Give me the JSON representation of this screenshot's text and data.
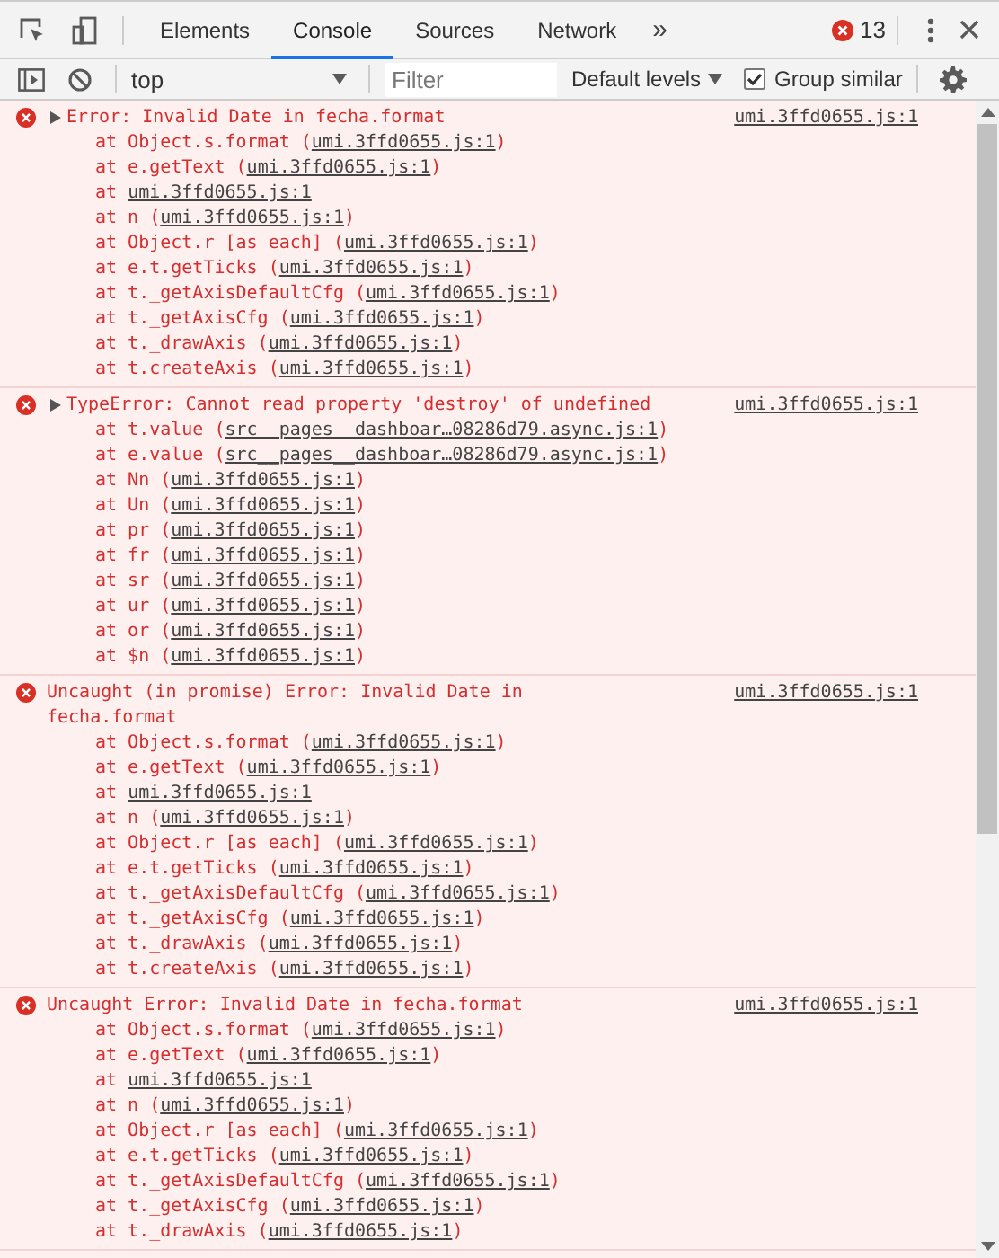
{
  "toolbar": {
    "tabs": [
      {
        "label": "Elements",
        "selected": false
      },
      {
        "label": "Console",
        "selected": true
      },
      {
        "label": "Sources",
        "selected": false
      },
      {
        "label": "Network",
        "selected": false
      }
    ],
    "more_tabs": "»",
    "error_count": "13"
  },
  "console_toolbar": {
    "context": "top",
    "filter": {
      "placeholder": "Filter"
    },
    "levels": "Default levels",
    "group_similar": {
      "label": "Group similar",
      "checked": true
    }
  },
  "messages": [
    {
      "toggle": {
        "expanded": false
      },
      "text": "Error: Invalid Date in fecha.format",
      "source": "umi.3ffd0655.js:1",
      "stack": [
        {
          "before": "at Object.s.format (",
          "link": "umi.3ffd0655.js:1",
          "after": ")"
        },
        {
          "before": "at e.getText (",
          "link": "umi.3ffd0655.js:1",
          "after": ")"
        },
        {
          "before": "at ",
          "link": "umi.3ffd0655.js:1"
        },
        {
          "before": "at n (",
          "link": "umi.3ffd0655.js:1",
          "after": ")"
        },
        {
          "before": "at Object.r [as each] (",
          "link": "umi.3ffd0655.js:1",
          "after": ")"
        },
        {
          "before": "at e.t.getTicks (",
          "link": "umi.3ffd0655.js:1",
          "after": ")"
        },
        {
          "before": "at t._getAxisDefaultCfg (",
          "link": "umi.3ffd0655.js:1",
          "after": ")"
        },
        {
          "before": "at t._getAxisCfg (",
          "link": "umi.3ffd0655.js:1",
          "after": ")"
        },
        {
          "before": "at t._drawAxis (",
          "link": "umi.3ffd0655.js:1",
          "after": ")"
        },
        {
          "before": "at t.createAxis (",
          "link": "umi.3ffd0655.js:1",
          "after": ")"
        }
      ]
    },
    {
      "toggle": {
        "expanded": false
      },
      "text": "TypeError: Cannot read property 'destroy' of undefined",
      "source": "umi.3ffd0655.js:1",
      "stack": [
        {
          "before": "at t.value (",
          "link": "src__pages__dashboar…08286d79.async.js:1",
          "after": ")"
        },
        {
          "before": "at e.value (",
          "link": "src__pages__dashboar…08286d79.async.js:1",
          "after": ")"
        },
        {
          "before": "at Nn (",
          "link": "umi.3ffd0655.js:1",
          "after": ")"
        },
        {
          "before": "at Un (",
          "link": "umi.3ffd0655.js:1",
          "after": ")"
        },
        {
          "before": "at pr (",
          "link": "umi.3ffd0655.js:1",
          "after": ")"
        },
        {
          "before": "at fr (",
          "link": "umi.3ffd0655.js:1",
          "after": ")"
        },
        {
          "before": "at sr (",
          "link": "umi.3ffd0655.js:1",
          "after": ")"
        },
        {
          "before": "at ur (",
          "link": "umi.3ffd0655.js:1",
          "after": ")"
        },
        {
          "before": "at or (",
          "link": "umi.3ffd0655.js:1",
          "after": ")"
        },
        {
          "before": "at $n (",
          "link": "umi.3ffd0655.js:1",
          "after": ")"
        }
      ]
    },
    {
      "text": "Uncaught (in promise) Error: Invalid Date in fecha.format",
      "source": "umi.3ffd0655.js:1",
      "stack": [
        {
          "before": "at Object.s.format (",
          "link": "umi.3ffd0655.js:1",
          "after": ")"
        },
        {
          "before": "at e.getText (",
          "link": "umi.3ffd0655.js:1",
          "after": ")"
        },
        {
          "before": "at ",
          "link": "umi.3ffd0655.js:1"
        },
        {
          "before": "at n (",
          "link": "umi.3ffd0655.js:1",
          "after": ")"
        },
        {
          "before": "at Object.r [as each] (",
          "link": "umi.3ffd0655.js:1",
          "after": ")"
        },
        {
          "before": "at e.t.getTicks (",
          "link": "umi.3ffd0655.js:1",
          "after": ")"
        },
        {
          "before": "at t._getAxisDefaultCfg (",
          "link": "umi.3ffd0655.js:1",
          "after": ")"
        },
        {
          "before": "at t._getAxisCfg (",
          "link": "umi.3ffd0655.js:1",
          "after": ")"
        },
        {
          "before": "at t._drawAxis (",
          "link": "umi.3ffd0655.js:1",
          "after": ")"
        },
        {
          "before": "at t.createAxis (",
          "link": "umi.3ffd0655.js:1",
          "after": ")"
        }
      ]
    },
    {
      "text": "Uncaught Error: Invalid Date in fecha.format",
      "source": "umi.3ffd0655.js:1",
      "stack": [
        {
          "before": "at Object.s.format (",
          "link": "umi.3ffd0655.js:1",
          "after": ")"
        },
        {
          "before": "at e.getText (",
          "link": "umi.3ffd0655.js:1",
          "after": ")"
        },
        {
          "before": "at ",
          "link": "umi.3ffd0655.js:1"
        },
        {
          "before": "at n (",
          "link": "umi.3ffd0655.js:1",
          "after": ")"
        },
        {
          "before": "at Object.r [as each] (",
          "link": "umi.3ffd0655.js:1",
          "after": ")"
        },
        {
          "before": "at e.t.getTicks (",
          "link": "umi.3ffd0655.js:1",
          "after": ")"
        },
        {
          "before": "at t._getAxisDefaultCfg (",
          "link": "umi.3ffd0655.js:1",
          "after": ")"
        },
        {
          "before": "at t._getAxisCfg (",
          "link": "umi.3ffd0655.js:1",
          "after": ")"
        },
        {
          "before": "at t._drawAxis (",
          "link": "umi.3ffd0655.js:1",
          "after": ")"
        }
      ]
    }
  ]
}
